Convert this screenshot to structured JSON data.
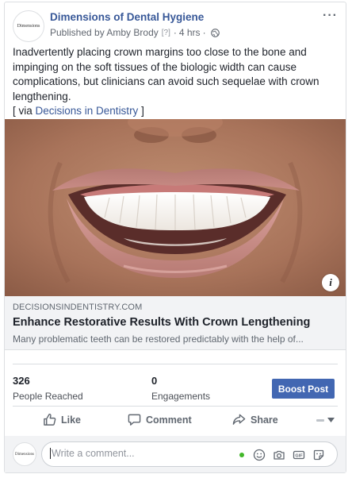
{
  "post": {
    "page_name": "Dimensions of Dental Hygiene",
    "published_by": "Published by Amby Brody",
    "help_marker": "[?]",
    "time": "4 hrs",
    "avatar_logo": "Dimensions",
    "body": "Inadvertently placing crown margins too close to the bone and impinging on the soft tissues of the biologic width can cause complications, but clinicians can avoid such sequelae with crown lengthening.",
    "via_prefix": "[ via ",
    "via_link": "Decisions in Dentistry",
    "via_suffix": " ]"
  },
  "link_preview": {
    "domain": "DECISIONSINDENTISTRY.COM",
    "title": "Enhance Restorative Results With Crown Lengthening",
    "description": "Many problematic teeth can be restored predictably with the help of..."
  },
  "insights": {
    "reached_value": "326",
    "reached_label": "People Reached",
    "engagements_value": "0",
    "engagements_label": "Engagements",
    "boost_label": "Boost Post"
  },
  "actions": {
    "like": "Like",
    "comment": "Comment",
    "share": "Share"
  },
  "comment": {
    "placeholder": "Write a comment..."
  },
  "colors": {
    "link_blue": "#385898",
    "boost_blue": "#4267b2",
    "online_green": "#42b72a"
  }
}
